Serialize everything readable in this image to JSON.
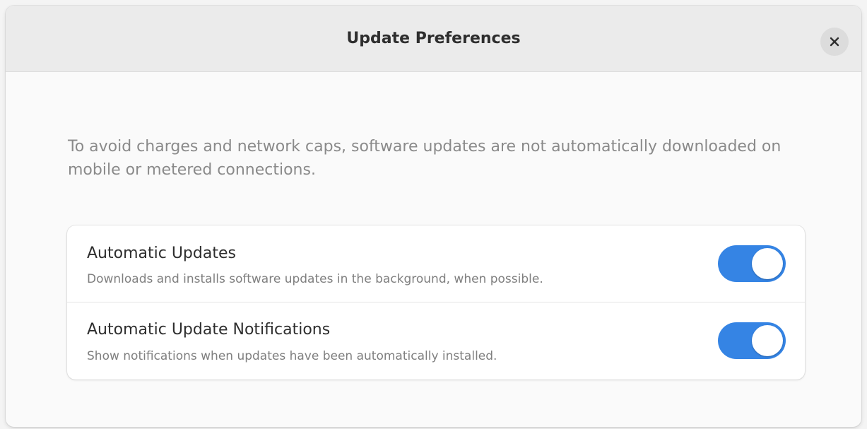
{
  "dialog": {
    "title": "Update Preferences",
    "close_icon": "close-icon"
  },
  "description": "To avoid charges and network caps, software updates are not automatically downloaded on mobile or metered connections.",
  "settings": [
    {
      "title": "Automatic Updates",
      "subtitle": "Downloads and installs software updates in the background, when possible.",
      "enabled": true
    },
    {
      "title": "Automatic Update Notifications",
      "subtitle": "Show notifications when updates have been automatically installed.",
      "enabled": true
    }
  ],
  "colors": {
    "accent": "#3584e4",
    "header_bg": "#ebebeb",
    "window_bg": "#fafafa",
    "card_bg": "#ffffff",
    "dim_text": "#7f7f7f"
  }
}
